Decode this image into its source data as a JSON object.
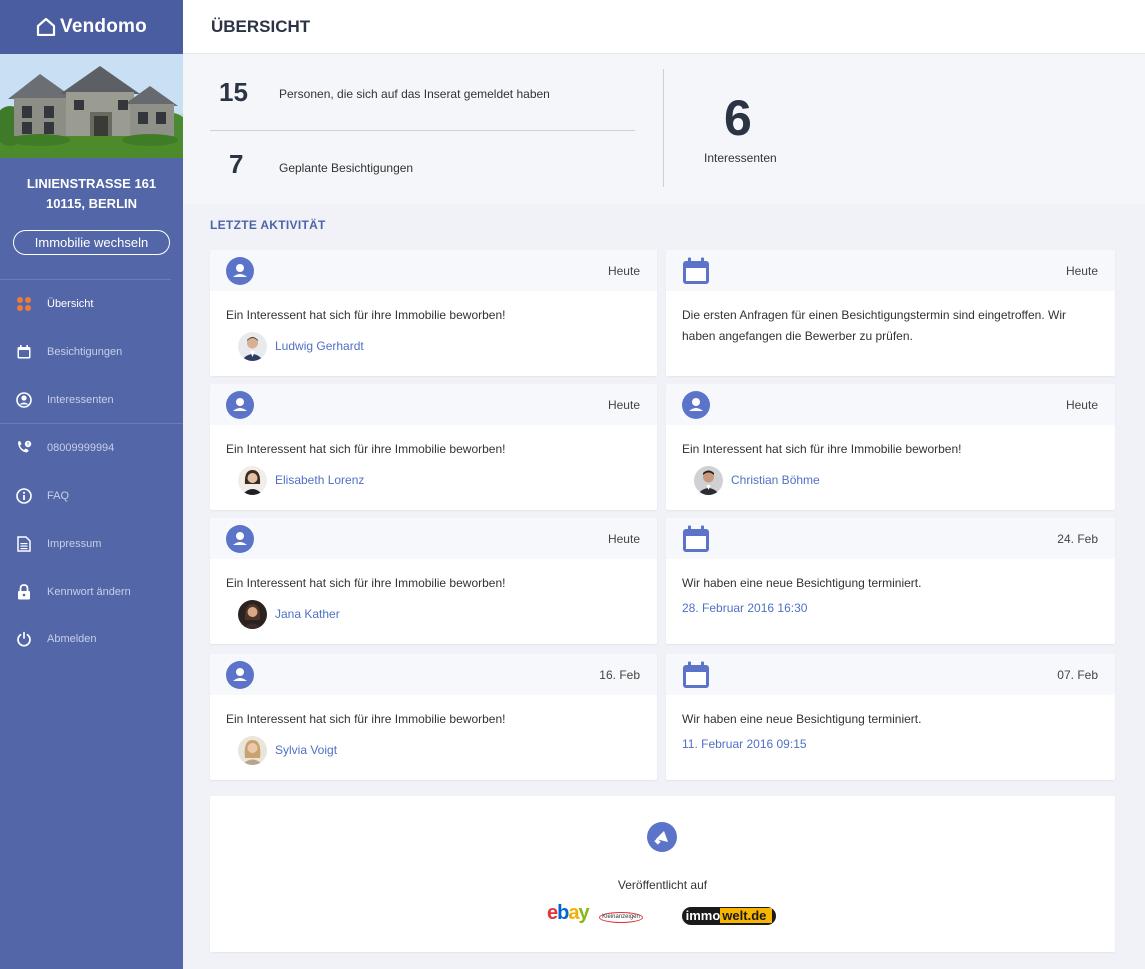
{
  "brand": {
    "name": "Vendomo"
  },
  "property": {
    "address_line1": "LINIENSTRASSE 161",
    "address_line2": "10115, BERLIN",
    "switch_label": "Immobilie wechseln"
  },
  "nav": [
    {
      "label": "Übersicht",
      "icon": "grid-dots-icon"
    },
    {
      "label": "Besichtigungen",
      "icon": "calendar-icon"
    },
    {
      "label": "Interessenten",
      "icon": "user-circle-icon"
    },
    {
      "label": "08009999994",
      "icon": "phone-icon"
    },
    {
      "label": "FAQ",
      "icon": "info-icon"
    },
    {
      "label": "Impressum",
      "icon": "document-icon"
    },
    {
      "label": "Kennwort ändern",
      "icon": "lock-icon"
    },
    {
      "label": "Abmelden",
      "icon": "power-icon"
    }
  ],
  "header": {
    "title": "ÜBERSICHT"
  },
  "stats": {
    "applicants_count": "15",
    "applicants_label": "Personen, die sich auf das  Inserat gemeldet haben",
    "viewings_count": "7",
    "viewings_label": "Geplante Besichtigungen",
    "interested_count": "6",
    "interested_label": "Interessenten"
  },
  "activity": {
    "title": "LETZTE AKTIVITÄT",
    "left": [
      {
        "date": "Heute",
        "text": "Ein Interessent hat sich für ihre Immobilie beworben!",
        "name": "Ludwig Gerhardt"
      },
      {
        "date": "Heute",
        "text": "Ein Interessent hat sich für ihre Immobilie beworben!",
        "name": "Elisabeth Lorenz"
      },
      {
        "date": "Heute",
        "text": "Ein Interessent hat sich für ihre Immobilie beworben!",
        "name": "Jana Kather"
      },
      {
        "date": "16. Feb",
        "text": "Ein Interessent hat sich für ihre Immobilie beworben!",
        "name": "Sylvia Voigt"
      }
    ],
    "right": [
      {
        "date": "Heute",
        "text": "Die ersten Anfragen für einen Besichtigungstermin sind eingetroffen. Wir haben angefangen die Bewerber zu prüfen."
      },
      {
        "date": "Heute",
        "text": "Ein Interessent hat sich für ihre Immobilie beworben!",
        "name": "Christian Böhme"
      },
      {
        "date": "24. Feb",
        "text": "Wir haben eine neue Besichtigung terminiert.",
        "link": "28. Februar 2016 16:30"
      },
      {
        "date": "07. Feb",
        "text": "Wir haben eine neue Besichtigung terminiert.",
        "link": "11. Februar 2016 09:15"
      }
    ]
  },
  "publish": {
    "label": "Veröffentlicht auf",
    "ebay_logo": "ebay",
    "ebay_sub": "Kleinanzeigen",
    "immo_logo": "immowelt.de"
  },
  "colors": {
    "sidebar": "#5367a8",
    "accent": "#5b74c9",
    "link": "#4f70c4",
    "active_icon": "#f07a3c"
  }
}
